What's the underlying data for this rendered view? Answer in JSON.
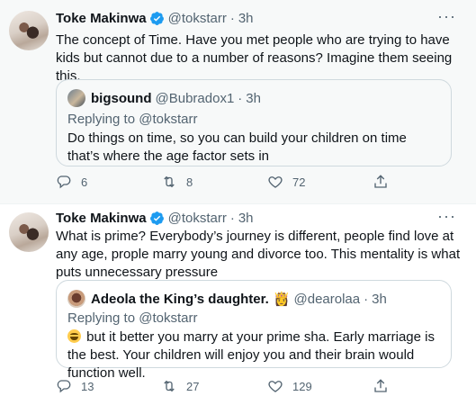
{
  "colors": {
    "verified": "#1d9bf0",
    "text": "#0f1419",
    "muted": "#536471",
    "border": "#cfd9de",
    "hover_bg": "#f7f9f9"
  },
  "tweets": [
    {
      "author_name": "Toke Makinwa",
      "verified_icon": "verified-badge-icon",
      "handle": "@tokstarr",
      "dot": "·",
      "time": "3h",
      "more": "···",
      "text": "The concept of Time. Have you met people who are trying to have kids but cannot due to a number of reasons? Imagine them seeing this.",
      "quote": {
        "author_name": "bigsound",
        "handle": "@Bubradox1",
        "dot": "·",
        "time": "3h",
        "replying_prefix": "Replying to ",
        "replying_to": "@tokstarr",
        "text": "Do things on time, so you can build your children on time that’s where the age factor sets in"
      },
      "stats": {
        "replies": "6",
        "retweets": "8",
        "likes": "72"
      }
    },
    {
      "author_name": "Toke Makinwa",
      "verified_icon": "verified-badge-icon",
      "handle": "@tokstarr",
      "dot": "·",
      "time": "3h",
      "more": "···",
      "text": "What is prime? Everybody’s journey is different, people find love at any age, prople marry young and divorce too. This mentality is what puts unnecessary pressure",
      "quote": {
        "author_name": "Adeola the King’s daughter.",
        "name_emoji": "👸",
        "handle": "@dearolaa",
        "dot": "·",
        "time": "3h",
        "replying_prefix": "Replying to ",
        "replying_to": "@tokstarr",
        "text_emoji_icon": "laughing-face-emoji",
        "text": " but it better you marry at your prime sha. Early marriage is the best. Your children will enjoy you and their brain would function well."
      },
      "stats": {
        "replies": "13",
        "retweets": "27",
        "likes": "129"
      }
    }
  ]
}
